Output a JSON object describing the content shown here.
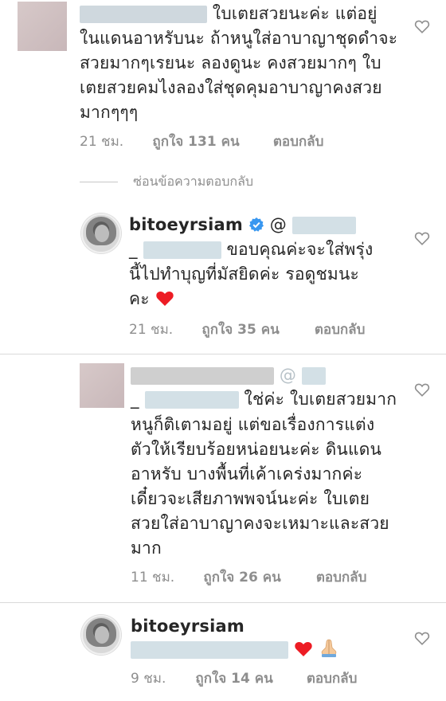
{
  "comments": [
    {
      "lines": [
        "ใบเตยสวยนะค่ะ แต่อยู่",
        "ในแดนอาหรับนะ ถ้าหนูใส่อาบาญาชุดดำจะ",
        "สวยมากๆเรยนะ ลองดูนะ คงสวยมากๆ ใบ",
        "เตยสวยคมไงลองใส่ชุดคุมอาบาญาคงสวย",
        "มากๆๆๆ"
      ],
      "time": "21 ชม.",
      "likes": "ถูกใจ 131 คน",
      "reply": "ตอบกลับ"
    },
    {
      "username": "bitoeyrsiam",
      "mention": "@",
      "lines": [
        "ขอบคุณค่ะจะใส่พรุ่ง",
        "นี้ไปทำบุญที่มัสยิดค่ะ รอดูชมนะ",
        "คะ"
      ],
      "time": "21 ชม.",
      "likes": "ถูกใจ 35 คน",
      "reply": "ตอบกลับ"
    },
    {
      "mention": "@",
      "lines": [
        "ใช่ค่ะ ใบเตยสวยมาก",
        "หนูก็ติเตามอยู่ แต่ขอเรื่องการแต่ง",
        "ตัวให้เรียบร้อยหน่อยนะค่ะ ดินแดน",
        "อาหรับ บางพื้นที่เค้าเคร่งมากค่ะ",
        "เดี๋ยวจะเสียภาพพจน์นะค่ะ ใบเตย",
        "สวยใส่อาบาญาคงจะเหมาะและสวย",
        "มาก"
      ],
      "time": "11 ชม.",
      "likes": "ถูกใจ 26 คน",
      "reply": "ตอบกลับ"
    },
    {
      "username": "bitoeyrsiam",
      "time": "9 ชม.",
      "likes": "ถูกใจ 14 คน",
      "reply": "ตอบกลับ"
    }
  ],
  "hide_replies": "ซ่อนข้อความตอบกลับ",
  "colors": {
    "text": "#262626",
    "meta": "#8e8e8e",
    "verified": "#3897f0",
    "heart_red": "#ed1c24",
    "blur": "#cfd8de"
  },
  "icons": [
    "heart-outline-icon",
    "verified-badge-icon",
    "red-heart-emoji",
    "praying-hands-emoji"
  ]
}
